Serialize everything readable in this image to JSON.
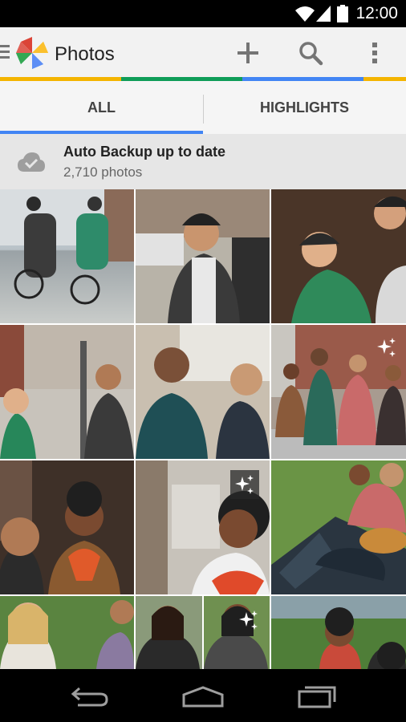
{
  "status_bar": {
    "time": "12:00",
    "icons": [
      "wifi-icon",
      "signal-icon",
      "battery-icon"
    ]
  },
  "app_bar": {
    "title": "Photos",
    "actions": [
      "add-icon",
      "search-icon",
      "overflow-menu-icon"
    ]
  },
  "brand_colors": [
    "#f4b400",
    "#0f9d58",
    "#4285f4",
    "#f4b400"
  ],
  "tabs": [
    {
      "label": "ALL",
      "selected": true
    },
    {
      "label": "HIGHLIGHTS",
      "selected": false
    }
  ],
  "backup": {
    "title": "Auto Backup up to date",
    "count": "2,710 photos",
    "icon": "cloud-check-icon"
  },
  "photos": [
    {
      "subject": "cyclists on street",
      "highlight": false
    },
    {
      "subject": "man with bike helmet laughing",
      "highlight": false
    },
    {
      "subject": "couple in bike helmets",
      "highlight": false
    },
    {
      "subject": "woman and man on sidewalk",
      "highlight": false
    },
    {
      "subject": "two men talking",
      "highlight": false
    },
    {
      "subject": "group walking",
      "highlight": true
    },
    {
      "subject": "two women smiling",
      "highlight": false
    },
    {
      "subject": "woman on phone",
      "highlight": true
    },
    {
      "subject": "friends with guitar on blanket",
      "highlight": false
    },
    {
      "subject": "woman in park",
      "highlight": false
    },
    {
      "subject": "women outdoors",
      "highlight": true
    },
    {
      "subject": "park scene",
      "highlight": false
    }
  ],
  "nav_bar": [
    "back-icon",
    "home-icon",
    "recents-icon"
  ]
}
